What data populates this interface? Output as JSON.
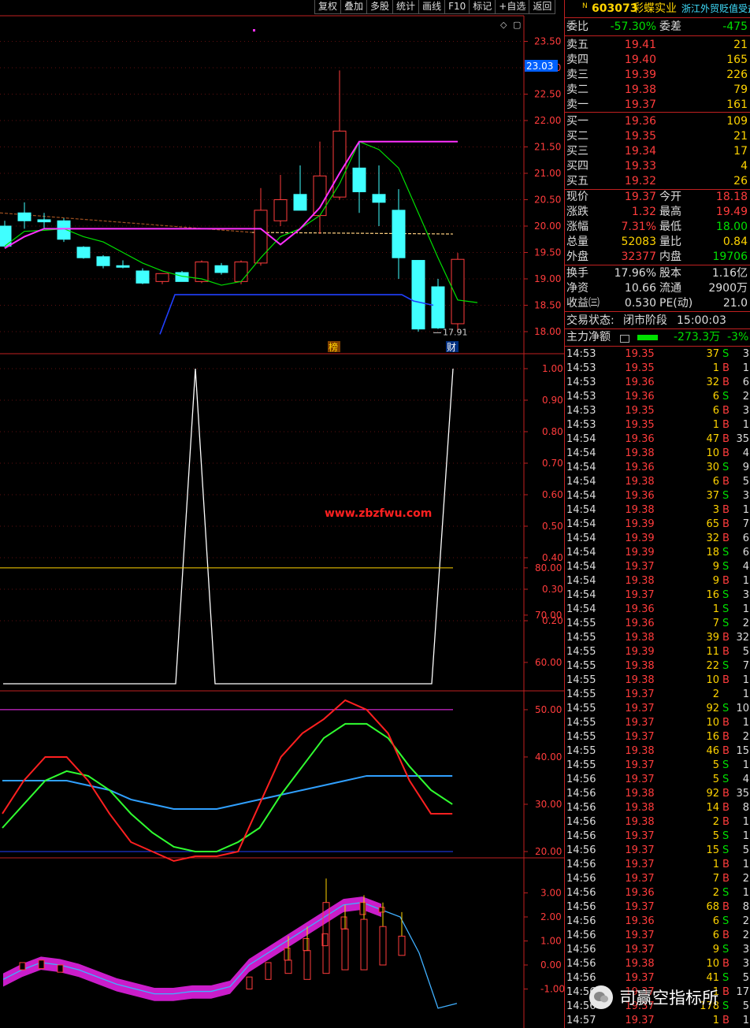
{
  "toolbar": [
    "复权",
    "叠加",
    "多股",
    "统计",
    "画线",
    "F10",
    "标记",
    "+自选",
    "返回"
  ],
  "stock": {
    "flag": "N",
    "code": "603073",
    "name": "彩蝶实业",
    "concept": "浙江外贸贬值受益"
  },
  "weibi": {
    "label": "委比",
    "value": "-57.30%",
    "label2": "委差",
    "value2": "-475"
  },
  "asks": [
    {
      "label": "卖五",
      "price": "19.41",
      "vol": "21"
    },
    {
      "label": "卖四",
      "price": "19.40",
      "vol": "165"
    },
    {
      "label": "卖三",
      "price": "19.39",
      "vol": "226"
    },
    {
      "label": "卖二",
      "price": "19.38",
      "vol": "79"
    },
    {
      "label": "卖一",
      "price": "19.37",
      "vol": "161"
    }
  ],
  "bids": [
    {
      "label": "买一",
      "price": "19.36",
      "vol": "109"
    },
    {
      "label": "买二",
      "price": "19.35",
      "vol": "21"
    },
    {
      "label": "买三",
      "price": "19.34",
      "vol": "17"
    },
    {
      "label": "买四",
      "price": "19.33",
      "vol": "4"
    },
    {
      "label": "买五",
      "price": "19.32",
      "vol": "26"
    }
  ],
  "quote": [
    {
      "l1": "现价",
      "v1": "19.37",
      "c1": "r",
      "l2": "今开",
      "v2": "18.18",
      "c2": "r"
    },
    {
      "l1": "涨跌",
      "v1": "1.32",
      "c1": "r",
      "l2": "最高",
      "v2": "19.49",
      "c2": "r"
    },
    {
      "l1": "涨幅",
      "v1": "7.31%",
      "c1": "r",
      "l2": "最低",
      "v2": "18.00",
      "c2": "g"
    },
    {
      "l1": "总量",
      "v1": "52083",
      "c1": "y",
      "l2": "量比",
      "v2": "0.84",
      "c2": "y"
    },
    {
      "l1": "外盘",
      "v1": "32377",
      "c1": "r",
      "l2": "内盘",
      "v2": "19706",
      "c2": "g"
    }
  ],
  "stats": [
    {
      "l1": "换手",
      "v1": "17.96%",
      "l2": "股本",
      "v2": "1.16亿"
    },
    {
      "l1": "净资",
      "v1": "10.66",
      "l2": "流通",
      "v2": "2900万"
    },
    {
      "l1": "收益㈢",
      "v1": "0.530",
      "l2": "PE(动)",
      "v2": "21.0"
    }
  ],
  "status": {
    "label": "交易状态:",
    "value": "闭市阶段",
    "time": "15:00:03"
  },
  "mainflow": {
    "label": "主力净额",
    "value": "-273.3万",
    "pct": "-3%"
  },
  "ticks": [
    [
      "14:53",
      "19.35",
      "37",
      "S",
      "3"
    ],
    [
      "14:53",
      "19.35",
      "1",
      "B",
      "1"
    ],
    [
      "14:53",
      "19.36",
      "32",
      "B",
      "6"
    ],
    [
      "14:53",
      "19.36",
      "6",
      "S",
      "2"
    ],
    [
      "14:53",
      "19.35",
      "6",
      "B",
      "3"
    ],
    [
      "14:53",
      "19.35",
      "1",
      "B",
      "1"
    ],
    [
      "14:54",
      "19.36",
      "47",
      "B",
      "35"
    ],
    [
      "14:54",
      "19.38",
      "10",
      "B",
      "4"
    ],
    [
      "14:54",
      "19.36",
      "30",
      "S",
      "9"
    ],
    [
      "14:54",
      "19.38",
      "6",
      "B",
      "5"
    ],
    [
      "14:54",
      "19.36",
      "37",
      "S",
      "3"
    ],
    [
      "14:54",
      "19.38",
      "3",
      "B",
      "1"
    ],
    [
      "14:54",
      "19.39",
      "65",
      "B",
      "7"
    ],
    [
      "14:54",
      "19.39",
      "32",
      "B",
      "6"
    ],
    [
      "14:54",
      "19.39",
      "18",
      "S",
      "6"
    ],
    [
      "14:54",
      "19.37",
      "9",
      "S",
      "4"
    ],
    [
      "14:54",
      "19.38",
      "9",
      "B",
      "1"
    ],
    [
      "14:54",
      "19.37",
      "16",
      "S",
      "3"
    ],
    [
      "14:54",
      "19.36",
      "1",
      "S",
      "1"
    ],
    [
      "14:55",
      "19.36",
      "7",
      "S",
      "2"
    ],
    [
      "14:55",
      "19.38",
      "39",
      "B",
      "32"
    ],
    [
      "14:55",
      "19.39",
      "11",
      "B",
      "5"
    ],
    [
      "14:55",
      "19.38",
      "22",
      "S",
      "7"
    ],
    [
      "14:55",
      "19.38",
      "10",
      "B",
      "1"
    ],
    [
      "14:55",
      "19.37",
      "2",
      "",
      "1"
    ],
    [
      "14:55",
      "19.37",
      "92",
      "S",
      "10"
    ],
    [
      "14:55",
      "19.37",
      "10",
      "B",
      "1"
    ],
    [
      "14:55",
      "19.37",
      "16",
      "B",
      "2"
    ],
    [
      "14:55",
      "19.38",
      "46",
      "B",
      "15"
    ],
    [
      "14:55",
      "19.37",
      "5",
      "S",
      "1"
    ],
    [
      "14:56",
      "19.37",
      "5",
      "S",
      "4"
    ],
    [
      "14:56",
      "19.38",
      "92",
      "B",
      "35"
    ],
    [
      "14:56",
      "19.38",
      "14",
      "B",
      "8"
    ],
    [
      "14:56",
      "19.38",
      "2",
      "B",
      "1"
    ],
    [
      "14:56",
      "19.37",
      "5",
      "S",
      "1"
    ],
    [
      "14:56",
      "19.37",
      "15",
      "S",
      "5"
    ],
    [
      "14:56",
      "19.37",
      "1",
      "B",
      "1"
    ],
    [
      "14:56",
      "19.37",
      "7",
      "B",
      "2"
    ],
    [
      "14:56",
      "19.36",
      "2",
      "S",
      "1"
    ],
    [
      "14:56",
      "19.37",
      "68",
      "B",
      "8"
    ],
    [
      "14:56",
      "19.36",
      "6",
      "S",
      "2"
    ],
    [
      "14:56",
      "19.37",
      "6",
      "B",
      "2"
    ],
    [
      "14:56",
      "19.37",
      "9",
      "S",
      "3"
    ],
    [
      "14:56",
      "19.38",
      "10",
      "B",
      "3"
    ],
    [
      "14:56",
      "19.37",
      "41",
      "S",
      "5"
    ],
    [
      "14:56",
      "19.37",
      "1",
      "B",
      "17"
    ],
    [
      "14:56",
      "19.37",
      "178",
      "S",
      "5"
    ],
    [
      "14:57",
      "19.37",
      "1",
      "B",
      "1"
    ]
  ],
  "watermark": "www.zbzfwu.com",
  "wechat": "司赢空指标所",
  "colors": {
    "up": "#ff3c3c",
    "down": "#40ffff",
    "ma5": "#00e000",
    "ma10": "#ff30ff",
    "level": "#2040ff"
  },
  "chart_data": [
    {
      "type": "candlestick",
      "price_ticks": [
        "23.50",
        "23.00",
        "22.50",
        "22.00",
        "21.50",
        "21.00",
        "20.50",
        "20.00",
        "19.50",
        "19.00",
        "18.50",
        "18.00"
      ],
      "current_price_tag": "23.03",
      "low_label": "17.91",
      "markers": [
        "榜",
        "财"
      ],
      "candles": [
        {
          "o": 20.0,
          "h": 20.1,
          "l": 19.6,
          "c": 19.62
        },
        {
          "o": 20.25,
          "h": 20.45,
          "l": 19.95,
          "c": 20.1
        },
        {
          "o": 20.12,
          "h": 20.25,
          "l": 19.95,
          "c": 20.08
        },
        {
          "o": 20.1,
          "h": 20.15,
          "l": 19.7,
          "c": 19.75
        },
        {
          "o": 19.6,
          "h": 19.62,
          "l": 19.38,
          "c": 19.4
        },
        {
          "o": 19.42,
          "h": 19.45,
          "l": 19.2,
          "c": 19.25
        },
        {
          "o": 19.25,
          "h": 19.35,
          "l": 19.2,
          "c": 19.22
        },
        {
          "o": 19.15,
          "h": 19.2,
          "l": 18.9,
          "c": 18.92
        },
        {
          "o": 18.95,
          "h": 19.1,
          "l": 18.9,
          "c": 19.1
        },
        {
          "o": 19.12,
          "h": 19.15,
          "l": 18.95,
          "c": 18.95
        },
        {
          "o": 18.95,
          "h": 19.35,
          "l": 18.92,
          "c": 19.32
        },
        {
          "o": 19.25,
          "h": 19.3,
          "l": 19.08,
          "c": 19.12
        },
        {
          "o": 18.95,
          "h": 19.35,
          "l": 18.9,
          "c": 19.32
        },
        {
          "o": 19.3,
          "h": 20.72,
          "l": 19.25,
          "c": 20.3
        },
        {
          "o": 20.1,
          "h": 20.97,
          "l": 20.0,
          "c": 20.5
        },
        {
          "o": 20.6,
          "h": 21.15,
          "l": 20.3,
          "c": 20.3
        },
        {
          "o": 20.2,
          "h": 21.6,
          "l": 19.85,
          "c": 20.95
        },
        {
          "o": 20.55,
          "h": 22.95,
          "l": 20.5,
          "c": 21.8
        },
        {
          "o": 21.1,
          "h": 21.6,
          "l": 20.25,
          "c": 20.65
        },
        {
          "o": 20.6,
          "h": 21.15,
          "l": 20.0,
          "c": 20.45
        },
        {
          "o": 20.3,
          "h": 20.7,
          "l": 19.0,
          "c": 19.4
        },
        {
          "o": 19.35,
          "h": 19.35,
          "l": 18.0,
          "c": 18.05
        },
        {
          "o": 18.85,
          "h": 19.0,
          "l": 18.05,
          "c": 18.07
        },
        {
          "o": 18.15,
          "h": 19.49,
          "l": 18.0,
          "c": 19.37
        }
      ],
      "ma5": [
        19.62,
        19.9,
        19.92,
        19.95,
        19.8,
        19.7,
        19.5,
        19.3,
        19.15,
        19.05,
        19.0,
        18.88,
        18.95,
        19.4,
        19.8,
        19.95,
        20.2,
        20.8,
        21.6,
        21.45,
        21.1,
        20.25,
        19.4,
        18.6,
        18.55
      ],
      "ma10": [
        19.58,
        19.8,
        19.95,
        19.95,
        19.95,
        19.95,
        19.95,
        19.95,
        19.95,
        19.95,
        19.95,
        19.95,
        19.95,
        19.95,
        19.65,
        19.95,
        20.35,
        21.0,
        21.6,
        21.6,
        21.6,
        21.6,
        21.6,
        21.6
      ],
      "level_line": [
        17.95,
        18.7,
        18.7,
        18.7,
        18.7,
        18.7,
        18.7,
        18.7,
        18.7,
        18.7,
        18.7,
        18.7,
        18.7,
        18.7,
        18.58,
        18.5
      ]
    },
    {
      "type": "line",
      "y_ticks": [
        "1.00",
        "0.90",
        "0.80",
        "0.70",
        "0.60",
        "0.50",
        "0.40",
        "0.30",
        "0.20"
      ],
      "values": [
        0,
        0,
        0,
        0,
        0,
        0,
        0,
        0,
        0,
        1,
        0,
        0,
        0,
        0,
        0,
        0,
        0,
        0,
        0,
        0,
        0,
        0,
        0,
        1
      ]
    },
    {
      "type": "line",
      "y_ticks": [
        "80.00",
        "70.00",
        "60.00",
        "50.00",
        "40.00",
        "30.00",
        "20.00"
      ],
      "ref_lines": [
        80,
        50,
        20
      ],
      "red": [
        28,
        35,
        40,
        40,
        35,
        28,
        22,
        20,
        18,
        19,
        19,
        20,
        30,
        40,
        45,
        48,
        52,
        50,
        45,
        35,
        28,
        28
      ],
      "green": [
        25,
        30,
        35,
        37,
        36,
        33,
        28,
        24,
        21,
        20,
        20,
        22,
        25,
        32,
        38,
        44,
        47,
        47,
        44,
        38,
        33,
        30
      ],
      "blue": [
        35,
        35,
        35,
        35,
        34,
        33,
        31,
        30,
        29,
        29,
        29,
        30,
        31,
        32,
        33,
        34,
        35,
        36,
        36,
        36,
        36,
        36
      ]
    },
    {
      "type": "line",
      "y_ticks": [
        "3.00",
        "2.00",
        "1.00",
        "0.00",
        "-1.00"
      ],
      "values": [
        -0.6,
        -0.2,
        0.1,
        0.0,
        -0.2,
        -0.5,
        -0.8,
        -1.0,
        -1.2,
        -1.2,
        -1.1,
        -1.1,
        -0.9,
        0.0,
        0.5,
        1.0,
        1.5,
        2.0,
        2.5,
        2.6,
        2.3,
        2.0,
        0.5,
        -1.8,
        -1.6
      ]
    }
  ]
}
